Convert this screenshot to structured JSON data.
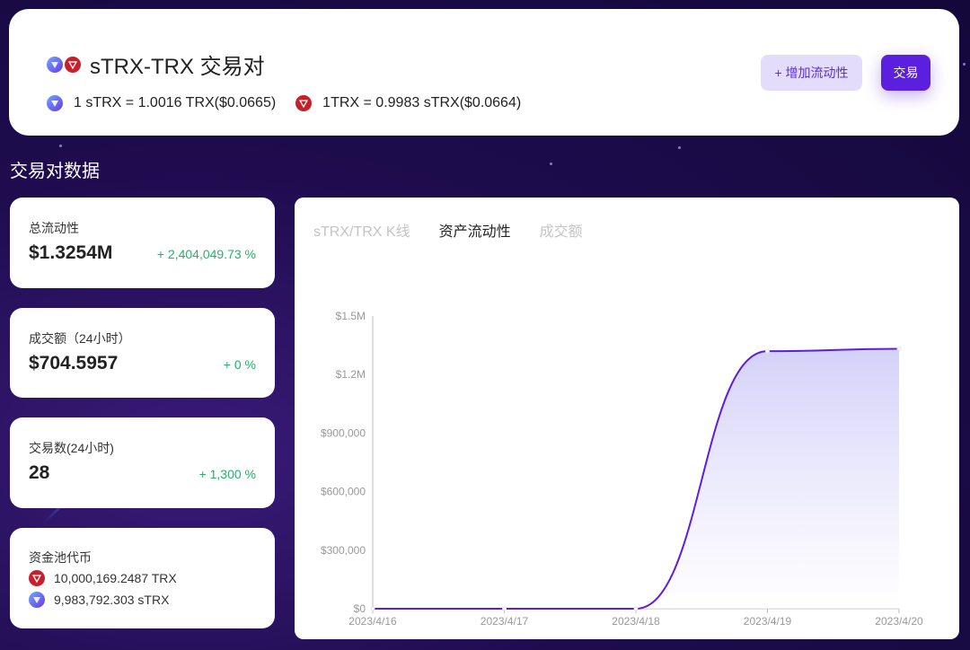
{
  "pair": {
    "title": "sTRX-TRX 交易对",
    "rate_strx": "1 sTRX = 1.0016 TRX($0.0665)",
    "rate_trx": "1TRX = 0.9983 sTRX($0.0664)"
  },
  "buttons": {
    "add_liquidity": "+ 增加流动性",
    "trade": "交易"
  },
  "section_title": "交易对数据",
  "stats": {
    "liquidity": {
      "label": "总流动性",
      "value": "$1.3254M",
      "change": "+ 2,404,049.73 %"
    },
    "volume": {
      "label": "成交额（24小时）",
      "value": "$704.5957",
      "change": "+ 0 %"
    },
    "tx_count": {
      "label": "交易数(24小时)",
      "value": "28",
      "change": "+ 1,300 %"
    },
    "pool": {
      "label": "资金池代币",
      "trx_amount": "10,000,169.2487 TRX",
      "strx_amount": "9,983,792.303 sTRX"
    }
  },
  "tabs": [
    {
      "label": "sTRX/TRX K线",
      "active": false
    },
    {
      "label": "资产流动性",
      "active": true
    },
    {
      "label": "成交额",
      "active": false
    }
  ],
  "icons": {
    "strx": "strx-coin-icon",
    "trx": "trx-coin-icon"
  },
  "colors": {
    "accent": "#5b1fe0",
    "positive": "#20b26b",
    "trx_red": "#c8202a",
    "line": "#5b1fe0"
  },
  "chart_data": {
    "type": "area",
    "x": [
      "2023/4/16",
      "2023/4/17",
      "2023/4/18",
      "2023/4/19",
      "2023/4/20"
    ],
    "values": [
      0,
      0,
      0,
      1320000,
      1332000
    ],
    "y_ticks": [
      "$0",
      "$300,000",
      "$600,000",
      "$900,000",
      "$1.2M",
      "$1.5M"
    ],
    "y_tick_values": [
      0,
      300000,
      600000,
      900000,
      1200000,
      1500000
    ],
    "ylim": [
      0,
      1500000
    ],
    "title": "",
    "xlabel": "",
    "ylabel": "",
    "grid": false
  }
}
